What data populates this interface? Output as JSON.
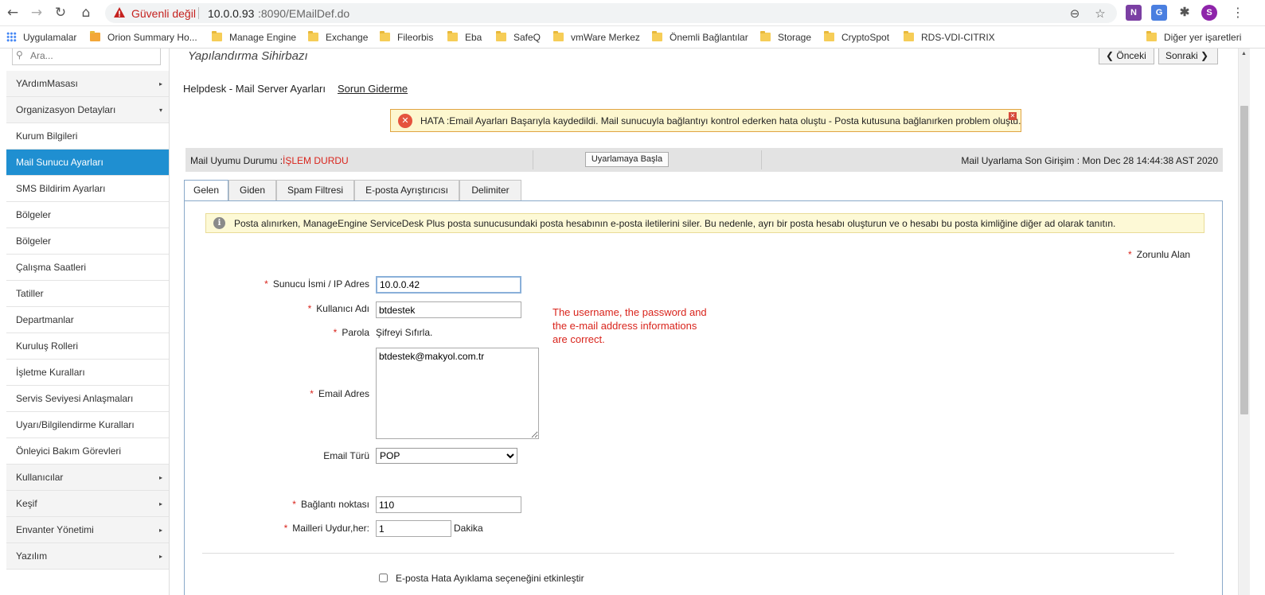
{
  "browser": {
    "security_label": "Güvenli değil",
    "url_host": "10.0.0.93",
    "url_rest": ":8090/EMailDef.do",
    "profile_initial": "S",
    "other_bookmarks": "Diğer yer işaretleri"
  },
  "bookmarks": [
    {
      "label": "Uygulamalar",
      "icon": "apps-grid-icon"
    },
    {
      "label": "Orion Summary Ho...",
      "icon": "orion-icon"
    },
    {
      "label": "Manage Engine",
      "icon": "folder-icon"
    },
    {
      "label": "Exchange",
      "icon": "folder-icon"
    },
    {
      "label": "Fileorbis",
      "icon": "folder-icon"
    },
    {
      "label": "Eba",
      "icon": "folder-icon"
    },
    {
      "label": "SafeQ",
      "icon": "folder-icon"
    },
    {
      "label": "vmWare Merkez",
      "icon": "folder-icon"
    },
    {
      "label": "Önemli Bağlantılar",
      "icon": "folder-icon"
    },
    {
      "label": "Storage",
      "icon": "folder-icon"
    },
    {
      "label": "CryptoSpot",
      "icon": "folder-icon"
    },
    {
      "label": "RDS-VDI-CITRIX",
      "icon": "folder-icon"
    }
  ],
  "sidebar": {
    "search_placeholder": "Ara...",
    "items": [
      {
        "label": "YArdımMasası",
        "type": "group",
        "arrow": "▸"
      },
      {
        "label": "Organizasyon Detayları",
        "type": "group",
        "arrow": "▾"
      },
      {
        "label": "Kurum Bilgileri",
        "type": "item"
      },
      {
        "label": "Mail Sunucu Ayarları",
        "type": "active"
      },
      {
        "label": "SMS Bildirim Ayarları",
        "type": "item"
      },
      {
        "label": "Bölgeler",
        "type": "item"
      },
      {
        "label": "Bölgeler",
        "type": "item"
      },
      {
        "label": "Çalışma Saatleri",
        "type": "item"
      },
      {
        "label": "Tatiller",
        "type": "item"
      },
      {
        "label": "Departmanlar",
        "type": "item"
      },
      {
        "label": "Kuruluş Rolleri",
        "type": "item"
      },
      {
        "label": "İşletme Kuralları",
        "type": "item"
      },
      {
        "label": "Servis Seviyesi Anlaşmaları",
        "type": "item"
      },
      {
        "label": "Uyarı/Bilgilendirme Kuralları",
        "type": "item"
      },
      {
        "label": "Önleyici Bakım Görevleri",
        "type": "item"
      },
      {
        "label": "Kullanıcılar",
        "type": "group",
        "arrow": "▸"
      },
      {
        "label": "Keşif",
        "type": "group",
        "arrow": "▸"
      },
      {
        "label": "Envanter Yönetimi",
        "type": "group",
        "arrow": "▸"
      },
      {
        "label": "Yazılım",
        "type": "group",
        "arrow": "▸"
      }
    ]
  },
  "header": {
    "wizard_title": "Yapılandırma Sihirbazı",
    "prev_label": "Önceki",
    "next_label": "Sonraki"
  },
  "page": {
    "heading": "Helpdesk - Mail Server Ayarları",
    "troubleshoot_link": "Sorun Giderme"
  },
  "error": {
    "text": "HATA :Email Ayarları Başarıyla kaydedildi. Mail sunucuyla bağlantıyı kontrol ederken hata oluştu - Posta kutusuna bağlanırken problem oluştu."
  },
  "status": {
    "label": "Mail Uyumu Durumu :",
    "value": "İŞLEM DURDU",
    "start_button": "Uyarlamaya Başla",
    "last_login_label": "Mail Uyarlama Son Girişim : ",
    "last_login_value": "Mon Dec 28 14:44:38 AST 2020"
  },
  "tabs": [
    "Gelen",
    "Giden",
    "Spam Filtresi",
    "E-posta Ayrıştırıcısı",
    "Delimiter"
  ],
  "form": {
    "info_text": "Posta alınırken, ManageEngine ServiceDesk Plus posta sunucusundaki posta hesabının e-posta iletilerini siler. Bu nedenle, ayrı bir posta hesabı oluşturun ve o hesabı bu posta kimliğine diğer ad olarak tanıtın.",
    "required_note": "Zorunlu Alan",
    "server_label": "Sunucu İsmi / IP Adres",
    "server_value": "10.0.0.42",
    "username_label": "Kullanıcı Adı",
    "username_value": "btdestek",
    "password_label": "Parola",
    "password_reset": "Şifreyi Sıfırla.",
    "email_label": "Email Adres",
    "email_value": "btdestek@makyol.com.tr",
    "email_type_label": "Email Türü",
    "email_type_value": "POP",
    "port_label": "Bağlantı noktası",
    "port_value": "110",
    "fetch_label": "Mailleri Uydur,her:",
    "fetch_value": "1",
    "fetch_unit": "Dakika",
    "debug_label": "E-posta Hata Ayıklama seçeneğini etkinleştir",
    "annotation": "The username, the password and the e-mail address informations are correct."
  }
}
